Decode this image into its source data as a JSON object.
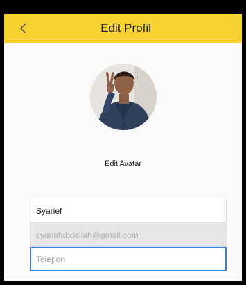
{
  "app_bar": {
    "title": "Edit Profil",
    "back_icon": "chevron-left-icon",
    "background": "#f5d22f"
  },
  "avatar": {
    "edit_label": "Edit Avatar"
  },
  "form": {
    "name_value": "Syarief",
    "email_value": "syariefabdallah@gmail.com",
    "phone_placeholder": "Telepon",
    "phone_focus_color": "#3a7fd6"
  }
}
